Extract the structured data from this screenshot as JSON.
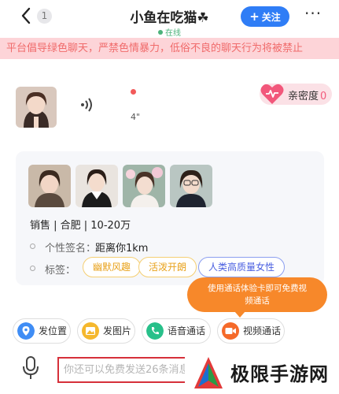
{
  "header": {
    "unread_count": "1",
    "title": "小鱼在吃猫☘",
    "status": "在线",
    "follow_label": "关注",
    "more": "···"
  },
  "banner": {
    "text": "平台倡导绿色聊天，严禁色情暴力，低俗不良的聊天行为将被禁止"
  },
  "profile": {
    "distance_seconds": "4\"",
    "intimacy_label": "亲密度",
    "intimacy_value": "0"
  },
  "card": {
    "photos": [
      "photo-1",
      "photo-2",
      "photo-3",
      "photo-4"
    ],
    "job_info": "销售 | 合肥 | 10-20万",
    "signature_label": "个性签名：",
    "signature_value": "距离你1km",
    "tags_label": "标签：",
    "tags": [
      "幽默风趣",
      "活泼开朗",
      "人类高质量女性"
    ]
  },
  "tooltip": {
    "line1": "使用通话体验卡即可免费视",
    "line2": "频通话"
  },
  "actions": [
    {
      "label": "发位置",
      "icon": "location-icon",
      "color": "#3f8df5"
    },
    {
      "label": "发图片",
      "icon": "image-icon",
      "color": "#f5b82e"
    },
    {
      "label": "语音通话",
      "icon": "phone-icon",
      "color": "#28c08a"
    },
    {
      "label": "视频通话",
      "icon": "video-icon",
      "color": "#f56a2a"
    }
  ],
  "input": {
    "placeholder": "你还可以免费发送26条消息"
  },
  "watermark": {
    "text": "极限手游网"
  },
  "colors": {
    "accent_blue": "#2f7df6",
    "online_green": "#4bb27a",
    "banner_bg": "#fdd4d8",
    "banner_text": "#f06b6b",
    "tooltip_orange": "#f7882a"
  }
}
